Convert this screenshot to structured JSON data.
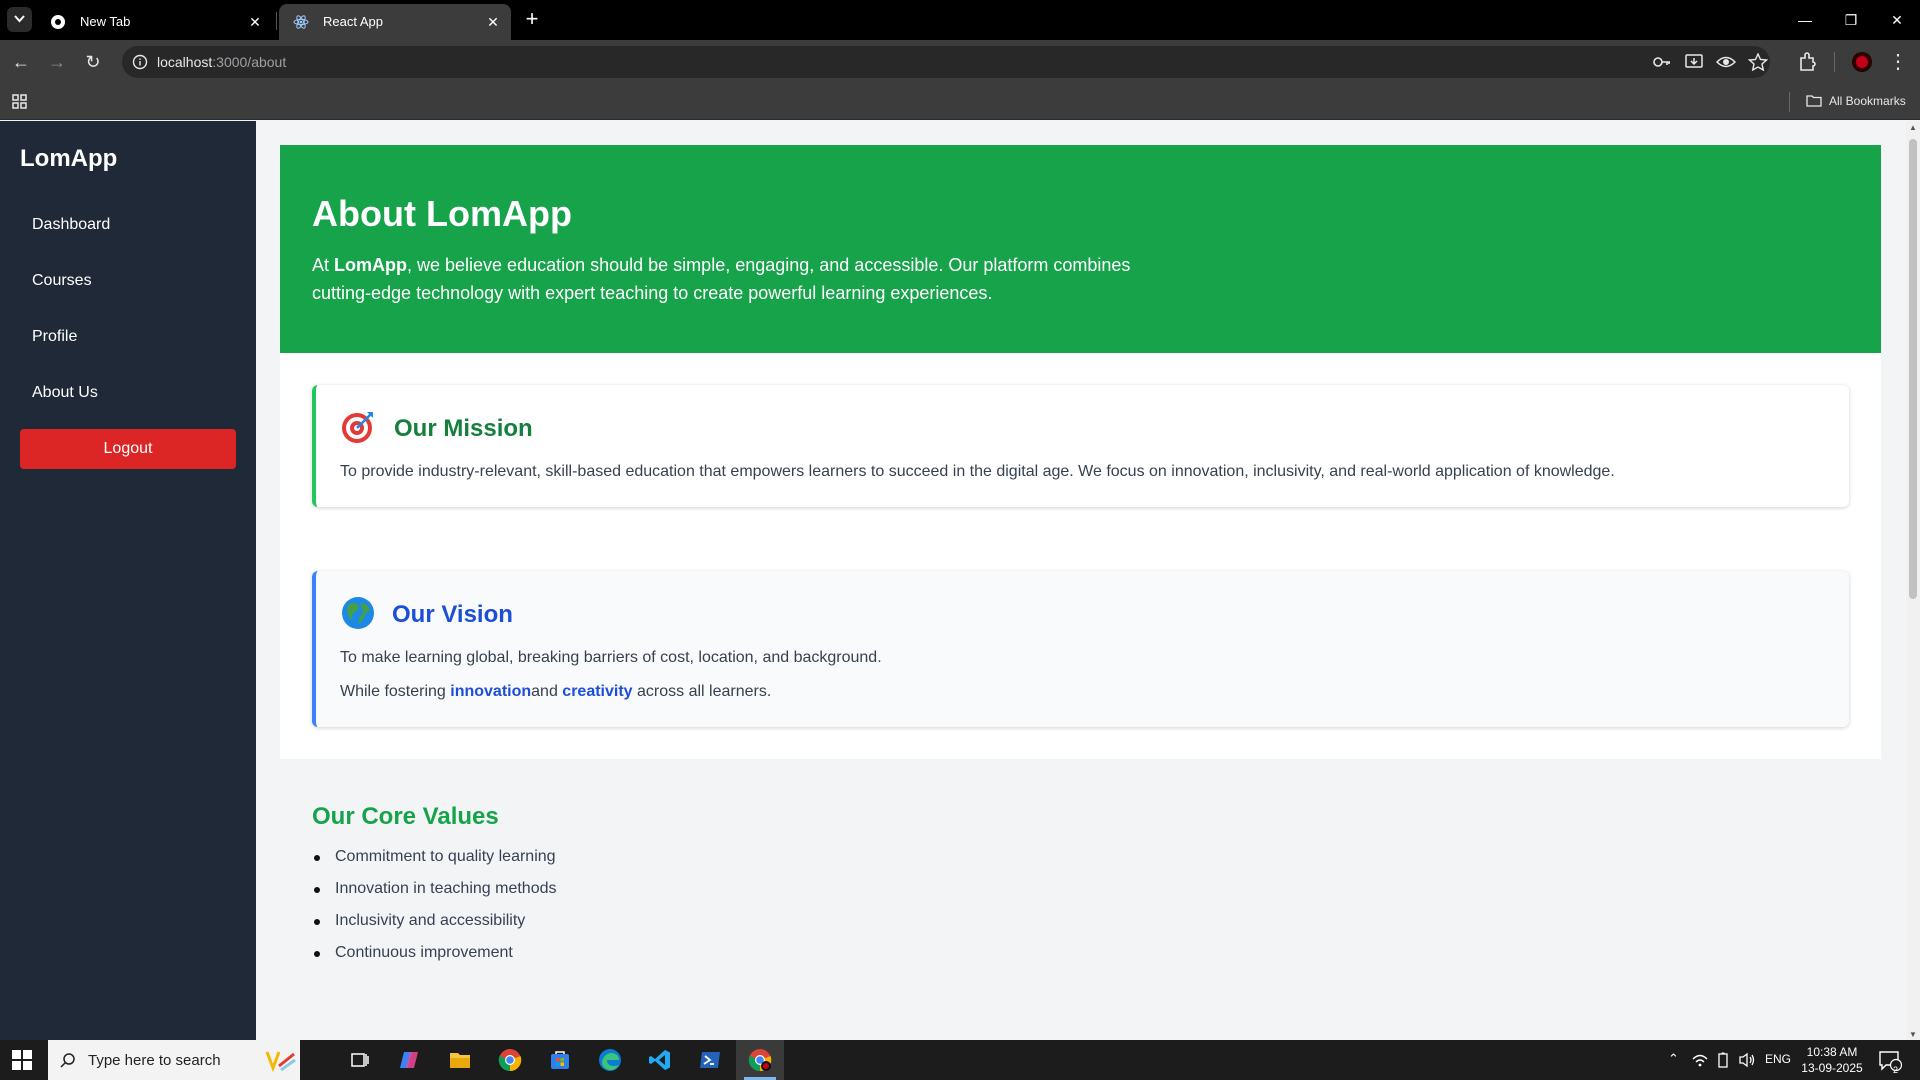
{
  "browser": {
    "tabs": [
      {
        "title": "New Tab",
        "active": false
      },
      {
        "title": "React App",
        "active": true
      }
    ],
    "url_host": "localhost",
    "url_path": ":3000/about",
    "bookmarks_label": "All Bookmarks"
  },
  "sidebar": {
    "logo": "LomApp",
    "items": [
      {
        "label": "Dashboard"
      },
      {
        "label": "Courses"
      },
      {
        "label": "Profile"
      },
      {
        "label": "About Us"
      }
    ],
    "logout_label": "Logout"
  },
  "hero": {
    "title": "About LomApp",
    "text_prefix": "At ",
    "text_brand": "LomApp",
    "text_rest": ", we believe education should be simple, engaging, and accessible. Our platform combines cutting-edge technology with expert teaching to create powerful learning experiences."
  },
  "mission": {
    "title": "Our Mission",
    "text": "To provide industry-relevant, skill-based education that empowers learners to succeed in the digital age. We focus on innovation, inclusivity, and real-world application of knowledge."
  },
  "vision": {
    "title": "Our Vision",
    "text1": "To make learning global, breaking barriers of cost, location, and background.",
    "text2_prefix": "While fostering ",
    "link1": "innovation",
    "text2_mid": "and ",
    "link2": "creativity",
    "text2_suffix": " across all learners."
  },
  "values": {
    "title": "Our Core Values",
    "items": [
      "Commitment to quality learning",
      "Innovation in teaching methods",
      "Inclusivity and accessibility",
      "Continuous improvement"
    ]
  },
  "taskbar": {
    "search_placeholder": "Type here to search",
    "language": "ENG",
    "time": "10:38 AM",
    "date": "13-09-2025",
    "notification_count": "2"
  },
  "colors": {
    "sidebar_bg": "#1f2937",
    "hero_bg": "#16a34a",
    "logout_bg": "#dc2626",
    "mission_accent": "#22c55e",
    "vision_accent": "#3b82f6"
  }
}
